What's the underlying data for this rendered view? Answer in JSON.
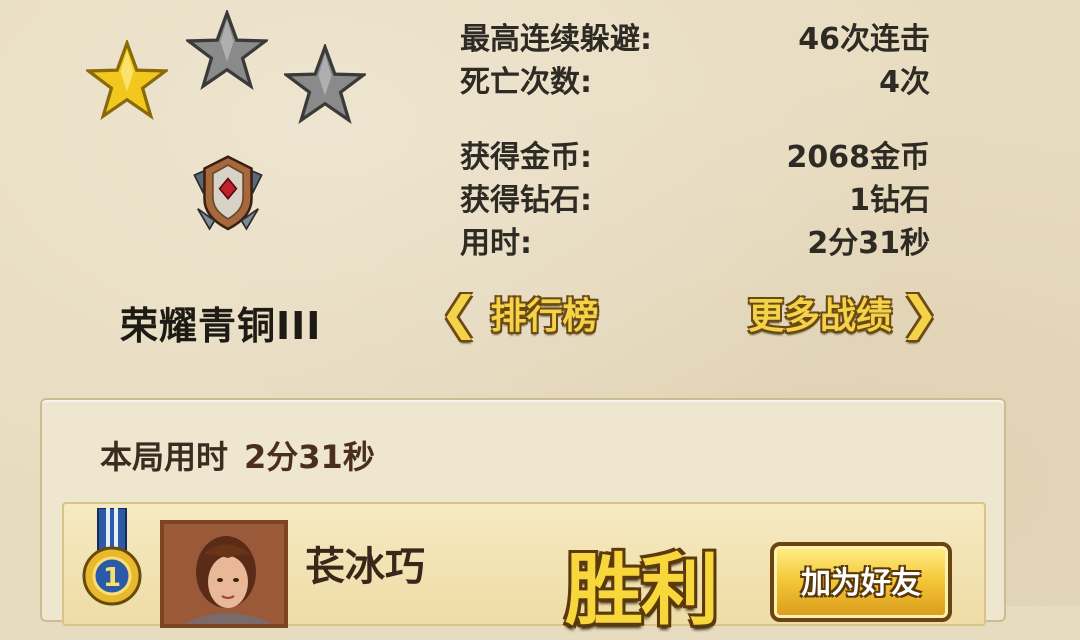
{
  "rating": {
    "stars_earned": 1,
    "stars_total": 3
  },
  "rank": {
    "name": "荣耀青铜III"
  },
  "stats": {
    "max_dodge_combo_label": "最高连续躲避:",
    "max_dodge_combo_value": "46次连击",
    "deaths_label": "死亡次数:",
    "deaths_value": "4次",
    "coins_label": "获得金币:",
    "coins_value": "2068金币",
    "diamonds_label": "获得钻石:",
    "diamonds_value": "1钻石",
    "time_label": "用时:",
    "time_value": "2分31秒"
  },
  "nav": {
    "leaderboard_label": "排行榜",
    "more_records_label": "更多战绩",
    "left_arrow": "❮",
    "right_arrow": "❯"
  },
  "match": {
    "time_label": "本局用时",
    "time_value": "2分31秒"
  },
  "player": {
    "placement": "1",
    "name": "苌冰巧",
    "result": "胜利",
    "add_friend_label": "加为好友"
  }
}
